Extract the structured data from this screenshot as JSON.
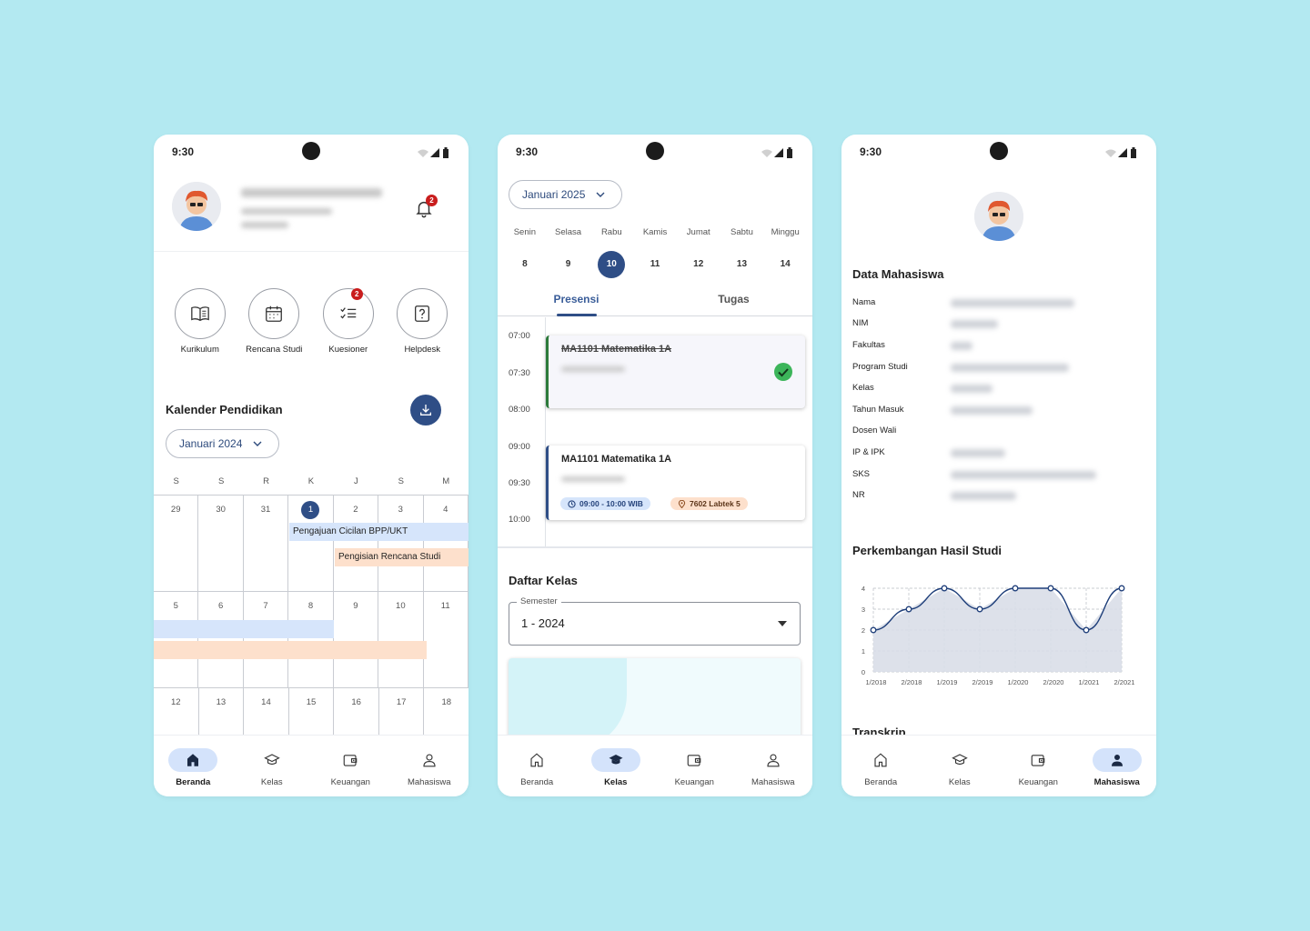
{
  "status": {
    "time": "9:30"
  },
  "screen1": {
    "notification_count": "2",
    "menu": [
      {
        "label": "Kurikulum",
        "icon": "book-icon"
      },
      {
        "label": "Rencana Studi",
        "icon": "calendar-icon"
      },
      {
        "label": "Kuesioner",
        "icon": "checklist-icon",
        "badge": "2"
      },
      {
        "label": "Helpdesk",
        "icon": "help-icon"
      }
    ],
    "calendar_title": "Kalender Pendidikan",
    "month_select": "Januari 2024",
    "weekdays": [
      "S",
      "S",
      "R",
      "K",
      "J",
      "S",
      "M"
    ],
    "weeks": [
      [
        "29",
        "30",
        "31",
        "1",
        "2",
        "3",
        "4"
      ],
      [
        "5",
        "6",
        "7",
        "8",
        "9",
        "10",
        "11"
      ],
      [
        "12",
        "13",
        "14",
        "15",
        "16",
        "17",
        "18"
      ]
    ],
    "events": [
      "Pengajuan Cicilan BPP/UKT",
      "Pengisian Rencana Studi"
    ],
    "colors": {
      "event_blue": "#d6e5fb",
      "event_orange": "#fde0cc",
      "primary": "#2f4e86"
    }
  },
  "screen2": {
    "month_select": "Januari 2025",
    "days": [
      {
        "name": "Senin",
        "date": "8"
      },
      {
        "name": "Selasa",
        "date": "9"
      },
      {
        "name": "Rabu",
        "date": "10"
      },
      {
        "name": "Kamis",
        "date": "11"
      },
      {
        "name": "Jumat",
        "date": "12"
      },
      {
        "name": "Sabtu",
        "date": "13"
      },
      {
        "name": "Minggu",
        "date": "14"
      }
    ],
    "tabs": [
      "Presensi",
      "Tugas"
    ],
    "times": [
      "07:00",
      "07:30",
      "08:00",
      "09:00",
      "09:30",
      "10:00"
    ],
    "class1": {
      "title": "MA1101 Matematika 1A"
    },
    "class2": {
      "title": "MA1101 Matematika 1A",
      "time": "09:00 - 10:00 WIB",
      "room": "7602 Labtek 5"
    },
    "list_title": "Daftar Kelas",
    "semester_label": "Semester",
    "semester_value": "1 - 2024"
  },
  "screen3": {
    "data_title": "Data Mahasiswa",
    "fields": [
      "Nama",
      "NIM",
      "Fakultas",
      "Program Studi",
      "Kelas",
      "Tahun Masuk",
      "Dosen Wali",
      "IP & IPK",
      "SKS",
      "NR"
    ],
    "chart_title": "Perkembangan Hasil Studi",
    "next_section": "Transkrip"
  },
  "nav": [
    "Beranda",
    "Kelas",
    "Keuangan",
    "Mahasiswa"
  ],
  "chart_data": {
    "type": "area",
    "title": "",
    "x": [
      "1/2018",
      "2/2018",
      "1/2019",
      "2/2019",
      "1/2020",
      "2/2020",
      "1/2021",
      "2/2021"
    ],
    "series": [
      {
        "values": [
          2,
          3,
          4,
          3,
          4,
          4,
          2,
          4
        ]
      }
    ],
    "ylim": [
      0,
      4
    ],
    "yticks": [
      "0",
      "1",
      "2",
      "3",
      "4"
    ],
    "grid": true,
    "color": "#1f3f7a"
  }
}
